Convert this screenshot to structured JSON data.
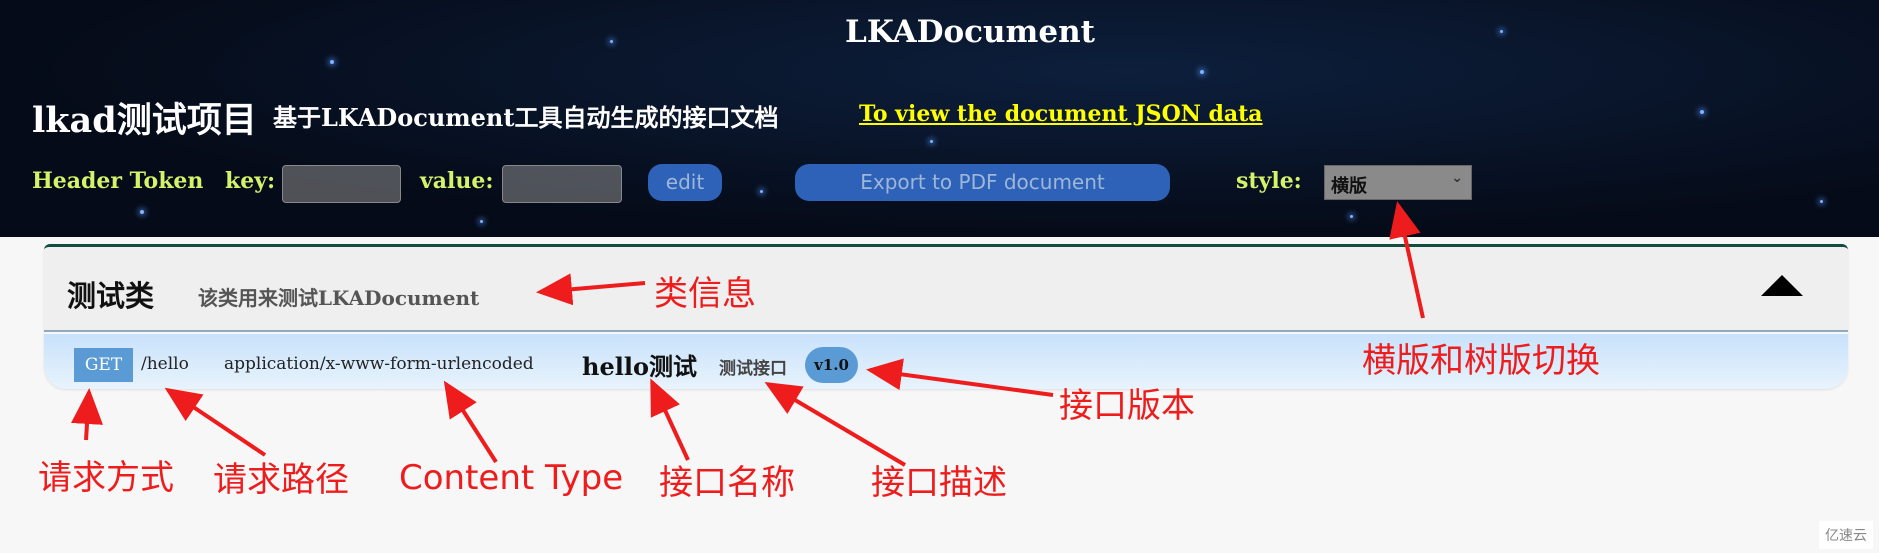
{
  "header": {
    "title": "LKADocument",
    "project_name": "lkad测试项目",
    "project_desc": "基于LKADocument工具自动生成的接口文档",
    "json_link": "To view the document JSON data",
    "token_label": "Header Token",
    "key_label": "key:",
    "key_value": "",
    "value_label": "value:",
    "value_value": "",
    "edit_button": "edit",
    "export_button": "Export to PDF document",
    "style_label": "style:",
    "style_selected": "横版"
  },
  "class_section": {
    "name": "测试类",
    "description": "该类用来测试LKADocument",
    "collapse_icon": "triangle-up-icon",
    "apis": [
      {
        "method": "GET",
        "path": "/hello",
        "content_type": "application/x-www-form-urlencoded",
        "name": "hello测试",
        "description": "测试接口",
        "version": "v1.0"
      }
    ]
  },
  "annotations": {
    "class_info": "类信息",
    "style_switch": "横版和树版切换",
    "api_version": "接口版本",
    "method": "请求方式",
    "path": "请求路径",
    "content_type": "Content Type",
    "api_name": "接口名称",
    "api_desc": "接口描述"
  },
  "colors": {
    "link": "#ffff00",
    "label": "#d4f26a",
    "badge": "#5b9bd5",
    "annotation": "#ee1c1c"
  },
  "watermark": "亿速云"
}
